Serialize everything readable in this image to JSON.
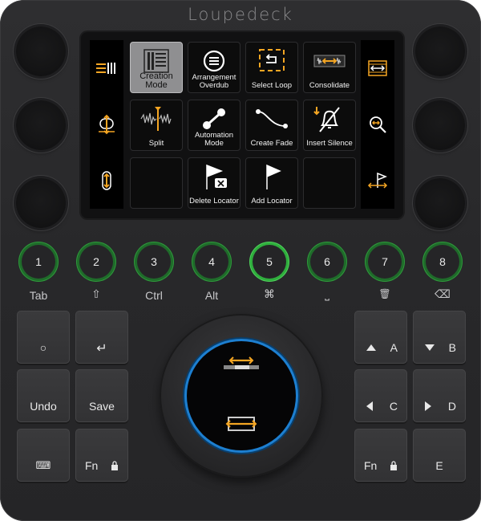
{
  "brand": "Loupedeck",
  "screen": {
    "tiles": [
      {
        "id": "creation-mode",
        "label": "Creation Mode",
        "icon": "creation-mode-icon",
        "active": true
      },
      {
        "id": "arrangement-overdub",
        "label": "Arrangement Overdub",
        "icon": "overdub-icon",
        "active": false
      },
      {
        "id": "select-loop",
        "label": "Select Loop",
        "icon": "select-loop-icon",
        "active": false
      },
      {
        "id": "consolidate",
        "label": "Consolidate",
        "icon": "consolidate-icon",
        "active": false
      },
      {
        "id": "split",
        "label": "Split",
        "icon": "split-icon",
        "active": false
      },
      {
        "id": "automation-mode",
        "label": "Automation Mode",
        "icon": "automation-icon",
        "active": false
      },
      {
        "id": "create-fade",
        "label": "Create Fade",
        "icon": "fade-curve-icon",
        "active": false
      },
      {
        "id": "insert-silence",
        "label": "Insert Silence",
        "icon": "silence-bell-icon",
        "active": false
      },
      {
        "id": "empty-1",
        "label": "",
        "icon": "",
        "active": false
      },
      {
        "id": "delete-locator",
        "label": "Delete Locator",
        "icon": "delete-locator-icon",
        "active": false
      },
      {
        "id": "add-locator",
        "label": "Add Locator",
        "icon": "flag-icon",
        "active": false
      },
      {
        "id": "empty-2",
        "label": "",
        "icon": "",
        "active": false
      }
    ]
  },
  "number_buttons": [
    {
      "num": "1",
      "label": "Tab"
    },
    {
      "num": "2",
      "label": "⇧"
    },
    {
      "num": "3",
      "label": "Ctrl"
    },
    {
      "num": "4",
      "label": "Alt"
    },
    {
      "num": "5",
      "label": "⌘"
    },
    {
      "num": "6",
      "label": "⎵"
    },
    {
      "num": "7",
      "label": "🗑"
    },
    {
      "num": "8",
      "label": "⌫"
    }
  ],
  "left_keys": {
    "circle": "○",
    "enter": "↵",
    "undo": "Undo",
    "save": "Save",
    "keyboard": "⌨",
    "fn": "Fn"
  },
  "right_keys": {
    "a": "A",
    "b": "B",
    "c": "C",
    "d": "D",
    "fn": "Fn",
    "e": "E"
  },
  "colors": {
    "accent_orange": "#f5a623",
    "ring_green": "#3cc14a",
    "dial_blue": "#1d7fd0"
  }
}
